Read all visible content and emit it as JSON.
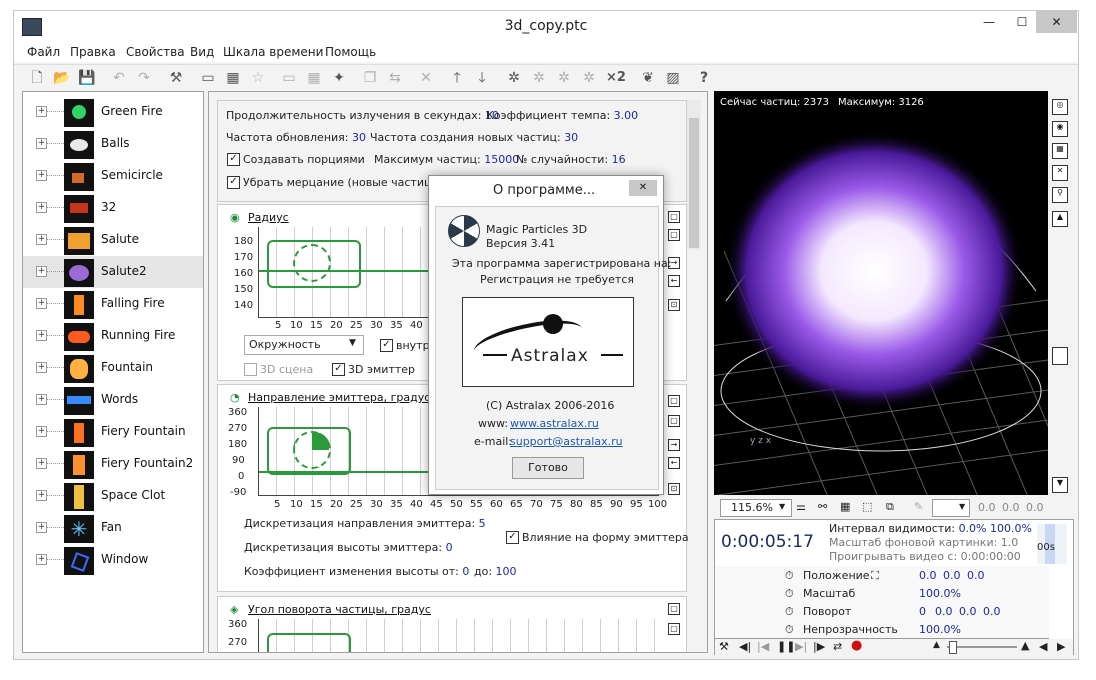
{
  "window": {
    "title": "3d_copy.ptc",
    "minimize": "—",
    "maximize": "☐",
    "close": "✕"
  },
  "menu": [
    "Файл",
    "Правка",
    "Свойства",
    "Вид",
    "Шкала времени",
    "Помощь"
  ],
  "tree": [
    {
      "label": "Green Fire",
      "color": "#2fd36a"
    },
    {
      "label": "Balls",
      "color": "#e8e8e8"
    },
    {
      "label": "Semicircle",
      "color": "#d46a2a"
    },
    {
      "label": "32",
      "color": "#c8341a"
    },
    {
      "label": "Salute",
      "color": "#f0a030"
    },
    {
      "label": "Salute2",
      "color": "#9a6ad6"
    },
    {
      "label": "Falling Fire",
      "color": "#ff8a20"
    },
    {
      "label": "Running Fire",
      "color": "#ff5a20"
    },
    {
      "label": "Fountain",
      "color": "#ffb040"
    },
    {
      "label": "Words",
      "color": "#3a8aff"
    },
    {
      "label": "Fiery Fountain",
      "color": "#ff7020"
    },
    {
      "label": "Fiery Fountain2",
      "color": "#ff9030"
    },
    {
      "label": "Space Clot",
      "color": "#f0c040"
    },
    {
      "label": "Fan",
      "color": "#6ac8ff"
    },
    {
      "label": "Window",
      "color": "#3a6aff"
    }
  ],
  "props": {
    "duration_label": "Продолжительность излучения в секундах:",
    "duration": "10",
    "tempo_label": "Коэффициент темпа:",
    "tempo": "3.00",
    "refresh_label": "Частота обновления:",
    "refresh": "30",
    "creation_label": "Частота создания новых частиц:",
    "creation": "30",
    "portions_label": "Создавать порциями",
    "max_label": "Максимум частиц:",
    "max": "15000",
    "random_label": "№ случайности:",
    "random": "16",
    "flicker_label": "Убрать мерцание (новые частицы за"
  },
  "radius": {
    "title": "Радиус",
    "yticks": [
      "180",
      "170",
      "160",
      "150",
      "140"
    ],
    "xticks": [
      "5",
      "10",
      "15",
      "20",
      "25",
      "30",
      "35",
      "40"
    ],
    "shape": "Окружность",
    "inside": "внутрь",
    "scene3d": "3D сцена",
    "emitter3d": "3D эмиттер"
  },
  "direction": {
    "title": "Направление эмиттера, градус",
    "yticks": [
      "360",
      "270",
      "180",
      "90",
      "0",
      "-90"
    ],
    "xticks": [
      "5",
      "10",
      "15",
      "20",
      "25",
      "30",
      "35",
      "40",
      "45",
      "50",
      "55",
      "60",
      "65",
      "70",
      "75",
      "80",
      "85",
      "90",
      "95",
      "100"
    ],
    "disc_label": "Дискретизация направления эмиттера:",
    "disc": "5",
    "influence": "Влияние на форму эмиттера",
    "height_label": "Дискретизация высоты эмиттера:",
    "height": "0",
    "coef_label": "Коэффициент изменения высоты от:",
    "coef_from": "0",
    "coef_to_label": "до:",
    "coef_to": "100"
  },
  "rotation": {
    "title": "Угол поворота частицы, градус",
    "yticks": [
      "360",
      "270"
    ]
  },
  "about": {
    "title": "О программе...",
    "product": "Magic Particles 3D",
    "version": "Версия 3.41",
    "reg1": "Эта программа зарегистрирована на:",
    "reg2": "Регистрация не требуется",
    "logo": "Astralax",
    "copyright": "(C) Astralax 2006-2016",
    "www_label": "www:",
    "www": "www.astralax.ru",
    "email_label": "e-mail:",
    "email": "support@astralax.ru",
    "ok": "Готово"
  },
  "viewport": {
    "count": "Сейчас частиц: 2373",
    "maximum": "Максимум: 3126",
    "zoom": "115.6%",
    "n1": "0.0",
    "n2": "0.0",
    "n3": "0.0"
  },
  "timeline": {
    "time": "0:00:05:17",
    "visibility_label": "Интервал видимости:",
    "vis_from": "0.0%",
    "vis_to": "100.0%",
    "bg_scale": "Масштаб фоновой картинки: 1.0",
    "video": "Проигрывать видео с: 0:00:00:00",
    "marker": "00s",
    "rows": [
      {
        "label": "Положение",
        "values": [
          "0.0",
          "0.0",
          "0.0"
        ]
      },
      {
        "label": "Масштаб",
        "values": [
          "100.0%"
        ]
      },
      {
        "label": "Поворот",
        "values": [
          "0",
          "0.0",
          "0.0",
          "0.0"
        ]
      },
      {
        "label": "Непрозрачность",
        "values": [
          "100.0%"
        ]
      }
    ]
  }
}
